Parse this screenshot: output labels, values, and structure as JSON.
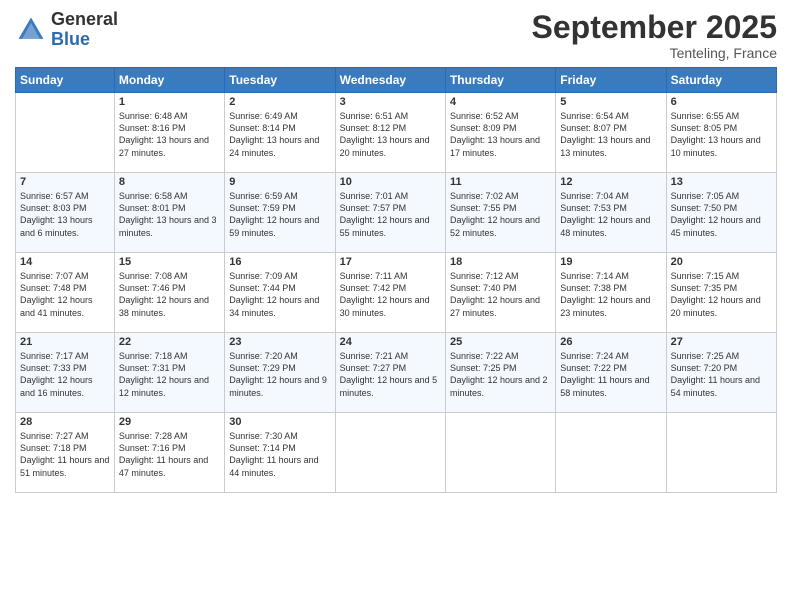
{
  "header": {
    "logo_general": "General",
    "logo_blue": "Blue",
    "month": "September 2025",
    "location": "Tenteling, France"
  },
  "days_of_week": [
    "Sunday",
    "Monday",
    "Tuesday",
    "Wednesday",
    "Thursday",
    "Friday",
    "Saturday"
  ],
  "weeks": [
    [
      {
        "day": "",
        "sunrise": "",
        "sunset": "",
        "daylight": ""
      },
      {
        "day": "1",
        "sunrise": "Sunrise: 6:48 AM",
        "sunset": "Sunset: 8:16 PM",
        "daylight": "Daylight: 13 hours and 27 minutes."
      },
      {
        "day": "2",
        "sunrise": "Sunrise: 6:49 AM",
        "sunset": "Sunset: 8:14 PM",
        "daylight": "Daylight: 13 hours and 24 minutes."
      },
      {
        "day": "3",
        "sunrise": "Sunrise: 6:51 AM",
        "sunset": "Sunset: 8:12 PM",
        "daylight": "Daylight: 13 hours and 20 minutes."
      },
      {
        "day": "4",
        "sunrise": "Sunrise: 6:52 AM",
        "sunset": "Sunset: 8:09 PM",
        "daylight": "Daylight: 13 hours and 17 minutes."
      },
      {
        "day": "5",
        "sunrise": "Sunrise: 6:54 AM",
        "sunset": "Sunset: 8:07 PM",
        "daylight": "Daylight: 13 hours and 13 minutes."
      },
      {
        "day": "6",
        "sunrise": "Sunrise: 6:55 AM",
        "sunset": "Sunset: 8:05 PM",
        "daylight": "Daylight: 13 hours and 10 minutes."
      }
    ],
    [
      {
        "day": "7",
        "sunrise": "Sunrise: 6:57 AM",
        "sunset": "Sunset: 8:03 PM",
        "daylight": "Daylight: 13 hours and 6 minutes."
      },
      {
        "day": "8",
        "sunrise": "Sunrise: 6:58 AM",
        "sunset": "Sunset: 8:01 PM",
        "daylight": "Daylight: 13 hours and 3 minutes."
      },
      {
        "day": "9",
        "sunrise": "Sunrise: 6:59 AM",
        "sunset": "Sunset: 7:59 PM",
        "daylight": "Daylight: 12 hours and 59 minutes."
      },
      {
        "day": "10",
        "sunrise": "Sunrise: 7:01 AM",
        "sunset": "Sunset: 7:57 PM",
        "daylight": "Daylight: 12 hours and 55 minutes."
      },
      {
        "day": "11",
        "sunrise": "Sunrise: 7:02 AM",
        "sunset": "Sunset: 7:55 PM",
        "daylight": "Daylight: 12 hours and 52 minutes."
      },
      {
        "day": "12",
        "sunrise": "Sunrise: 7:04 AM",
        "sunset": "Sunset: 7:53 PM",
        "daylight": "Daylight: 12 hours and 48 minutes."
      },
      {
        "day": "13",
        "sunrise": "Sunrise: 7:05 AM",
        "sunset": "Sunset: 7:50 PM",
        "daylight": "Daylight: 12 hours and 45 minutes."
      }
    ],
    [
      {
        "day": "14",
        "sunrise": "Sunrise: 7:07 AM",
        "sunset": "Sunset: 7:48 PM",
        "daylight": "Daylight: 12 hours and 41 minutes."
      },
      {
        "day": "15",
        "sunrise": "Sunrise: 7:08 AM",
        "sunset": "Sunset: 7:46 PM",
        "daylight": "Daylight: 12 hours and 38 minutes."
      },
      {
        "day": "16",
        "sunrise": "Sunrise: 7:09 AM",
        "sunset": "Sunset: 7:44 PM",
        "daylight": "Daylight: 12 hours and 34 minutes."
      },
      {
        "day": "17",
        "sunrise": "Sunrise: 7:11 AM",
        "sunset": "Sunset: 7:42 PM",
        "daylight": "Daylight: 12 hours and 30 minutes."
      },
      {
        "day": "18",
        "sunrise": "Sunrise: 7:12 AM",
        "sunset": "Sunset: 7:40 PM",
        "daylight": "Daylight: 12 hours and 27 minutes."
      },
      {
        "day": "19",
        "sunrise": "Sunrise: 7:14 AM",
        "sunset": "Sunset: 7:38 PM",
        "daylight": "Daylight: 12 hours and 23 minutes."
      },
      {
        "day": "20",
        "sunrise": "Sunrise: 7:15 AM",
        "sunset": "Sunset: 7:35 PM",
        "daylight": "Daylight: 12 hours and 20 minutes."
      }
    ],
    [
      {
        "day": "21",
        "sunrise": "Sunrise: 7:17 AM",
        "sunset": "Sunset: 7:33 PM",
        "daylight": "Daylight: 12 hours and 16 minutes."
      },
      {
        "day": "22",
        "sunrise": "Sunrise: 7:18 AM",
        "sunset": "Sunset: 7:31 PM",
        "daylight": "Daylight: 12 hours and 12 minutes."
      },
      {
        "day": "23",
        "sunrise": "Sunrise: 7:20 AM",
        "sunset": "Sunset: 7:29 PM",
        "daylight": "Daylight: 12 hours and 9 minutes."
      },
      {
        "day": "24",
        "sunrise": "Sunrise: 7:21 AM",
        "sunset": "Sunset: 7:27 PM",
        "daylight": "Daylight: 12 hours and 5 minutes."
      },
      {
        "day": "25",
        "sunrise": "Sunrise: 7:22 AM",
        "sunset": "Sunset: 7:25 PM",
        "daylight": "Daylight: 12 hours and 2 minutes."
      },
      {
        "day": "26",
        "sunrise": "Sunrise: 7:24 AM",
        "sunset": "Sunset: 7:22 PM",
        "daylight": "Daylight: 11 hours and 58 minutes."
      },
      {
        "day": "27",
        "sunrise": "Sunrise: 7:25 AM",
        "sunset": "Sunset: 7:20 PM",
        "daylight": "Daylight: 11 hours and 54 minutes."
      }
    ],
    [
      {
        "day": "28",
        "sunrise": "Sunrise: 7:27 AM",
        "sunset": "Sunset: 7:18 PM",
        "daylight": "Daylight: 11 hours and 51 minutes."
      },
      {
        "day": "29",
        "sunrise": "Sunrise: 7:28 AM",
        "sunset": "Sunset: 7:16 PM",
        "daylight": "Daylight: 11 hours and 47 minutes."
      },
      {
        "day": "30",
        "sunrise": "Sunrise: 7:30 AM",
        "sunset": "Sunset: 7:14 PM",
        "daylight": "Daylight: 11 hours and 44 minutes."
      },
      {
        "day": "",
        "sunrise": "",
        "sunset": "",
        "daylight": ""
      },
      {
        "day": "",
        "sunrise": "",
        "sunset": "",
        "daylight": ""
      },
      {
        "day": "",
        "sunrise": "",
        "sunset": "",
        "daylight": ""
      },
      {
        "day": "",
        "sunrise": "",
        "sunset": "",
        "daylight": ""
      }
    ]
  ]
}
